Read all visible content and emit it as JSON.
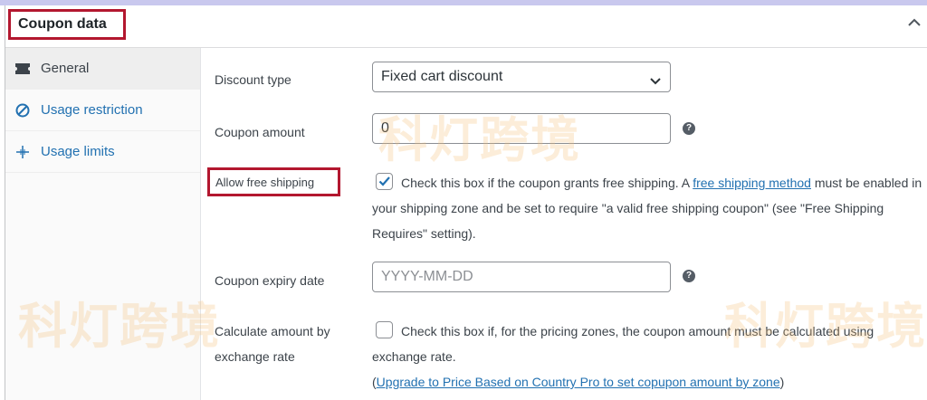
{
  "panel": {
    "title": "Coupon data"
  },
  "tabs": [
    {
      "label": "General",
      "icon": "ticket-icon",
      "active": true
    },
    {
      "label": "Usage restriction",
      "icon": "no-entry-icon",
      "active": false
    },
    {
      "label": "Usage limits",
      "icon": "plus-cross-icon",
      "active": false
    }
  ],
  "fields": {
    "discount_type": {
      "label": "Discount type",
      "value": "Fixed cart discount"
    },
    "coupon_amount": {
      "label": "Coupon amount",
      "value": "0"
    },
    "free_shipping": {
      "label": "Allow free shipping",
      "checked": true,
      "text_before": "Check this box if the coupon grants free shipping. A ",
      "link": "free shipping method",
      "text_after": " must be enabled in your shipping zone and be set to require \"a valid free shipping coupon\" (see \"Free Shipping Requires\" setting)."
    },
    "expiry_date": {
      "label": "Coupon expiry date",
      "placeholder": "YYYY-MM-DD"
    },
    "exchange_rate": {
      "label": "Calculate amount by exchange rate",
      "checked": false,
      "text": "Check this box if, for the pricing zones, the coupon amount must be calculated using exchange rate.",
      "paren_open": "(",
      "link": "Upgrade to Price Based on Country Pro to set copupon amount by zone",
      "paren_close": ")"
    }
  },
  "watermark": "科灯跨境",
  "colors": {
    "accent": "#2271b1",
    "highlight": "#b3172f"
  }
}
